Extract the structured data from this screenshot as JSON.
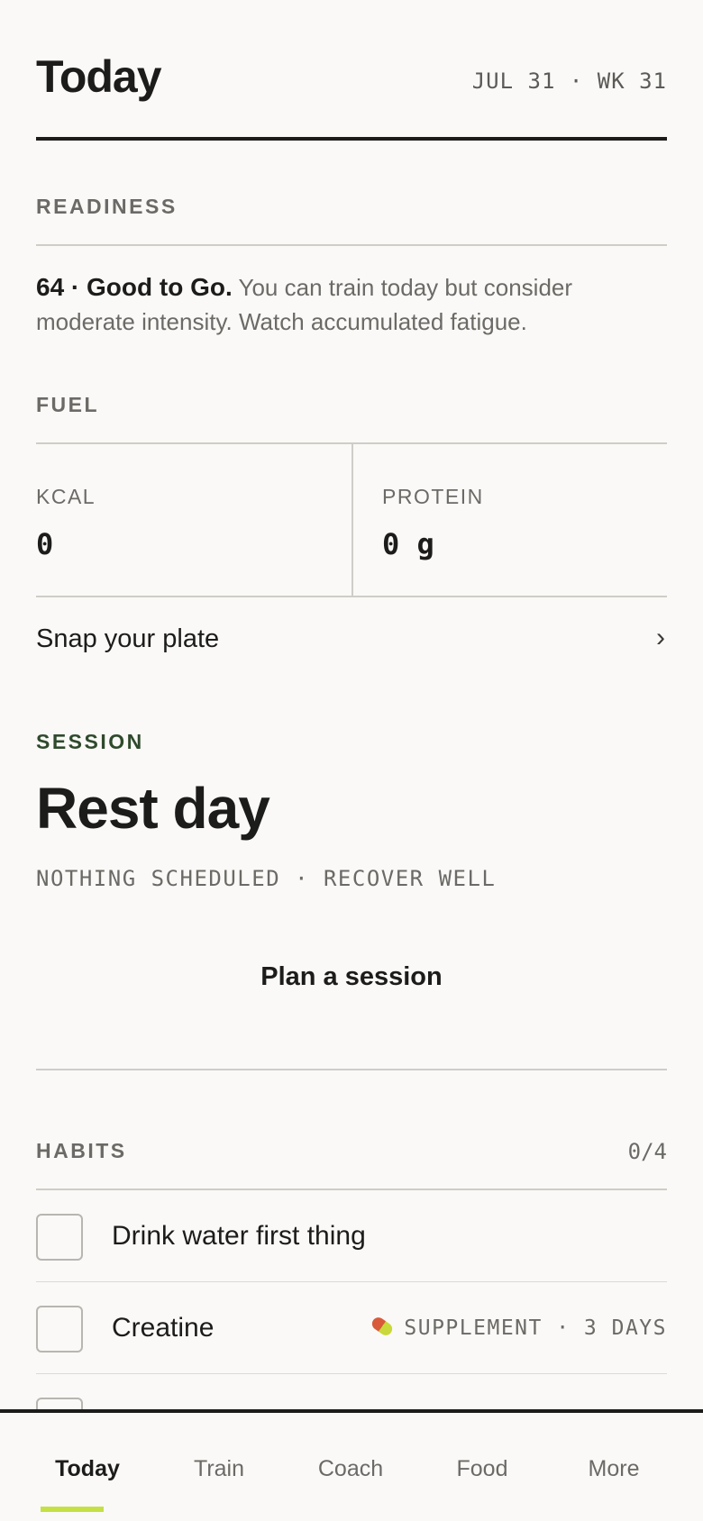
{
  "header": {
    "title": "Today",
    "date": "JUL 31 · WK 31"
  },
  "readiness": {
    "label": "READINESS",
    "score_text": "64 · Good to Go.",
    "description": " You can train today but consider moderate intensity. Watch accumulated fatigue."
  },
  "fuel": {
    "label": "FUEL",
    "kcal_label": "KCAL",
    "kcal_value": "0",
    "protein_label": "PROTEIN",
    "protein_value": "0 g",
    "snap_label": "Snap your plate",
    "chevron": "›"
  },
  "session": {
    "label": "SESSION",
    "title": "Rest day",
    "subtitle": "NOTHING SCHEDULED · RECOVER WELL",
    "plan_label": "Plan a session"
  },
  "habits": {
    "label": "HABITS",
    "count": "0/4",
    "items": [
      {
        "name": "Drink water first thing",
        "meta": "",
        "checked": false
      },
      {
        "name": "Creatine",
        "meta": "SUPPLEMENT · 3 DAYS",
        "icon": "pill-icon",
        "checked": false
      },
      {
        "name": "",
        "meta": "",
        "checked": false
      }
    ]
  },
  "nav": {
    "items": [
      {
        "label": "Today",
        "active": true
      },
      {
        "label": "Train",
        "active": false
      },
      {
        "label": "Coach",
        "active": false
      },
      {
        "label": "Food",
        "active": false
      },
      {
        "label": "More",
        "active": false
      }
    ],
    "accent": "#c5e045"
  },
  "colors": {
    "background": "#faf9f7",
    "text": "#1c1c1a",
    "muted": "#6b6a66",
    "session_accent": "#2f4a2c"
  }
}
